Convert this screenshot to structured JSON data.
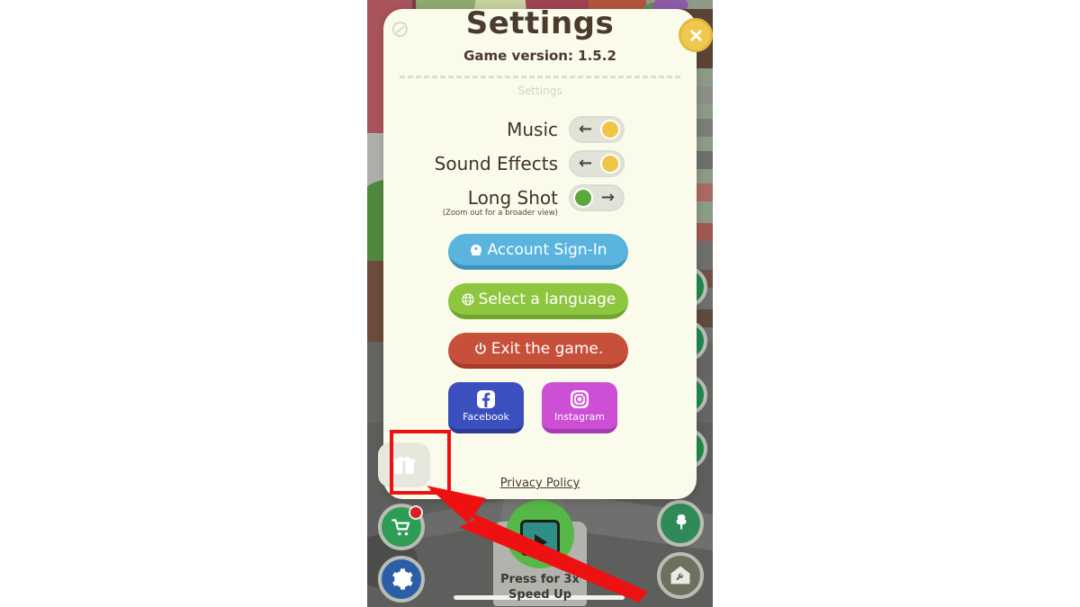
{
  "modal": {
    "title": "Settings",
    "corner_icon": "blocked-circle-icon",
    "close_icon": "close-icon",
    "game_version": "Game version: 1.5.2",
    "tab_label": "Settings",
    "toggles": [
      {
        "label": "Music",
        "state": "on",
        "knob_color": "#eec544",
        "arrow": "←",
        "arrow_side": "left"
      },
      {
        "label": "Sound Effects",
        "state": "on",
        "knob_color": "#eec544",
        "arrow": "←",
        "arrow_side": "left"
      },
      {
        "label": "Long Shot",
        "sub_label": "(Zoom out for a broader view)",
        "state": "off",
        "knob_color": "#58a83a",
        "arrow": "→",
        "arrow_side": "right"
      }
    ],
    "buttons": [
      {
        "label": "Account Sign-In",
        "icon": "person-badge-icon",
        "color": "#5ab4dd"
      },
      {
        "label": "Select a language",
        "icon": "globe-icon",
        "color": "#8ec63f"
      },
      {
        "label": "Exit the game.",
        "icon": "power-icon",
        "color": "#c7503a"
      }
    ],
    "social": [
      {
        "label": "Facebook",
        "icon": "facebook-icon",
        "color": "#3b4fbe"
      },
      {
        "label": "Instagram",
        "icon": "instagram-icon",
        "color": "#cc4fd6"
      }
    ],
    "gift_icon": "gift-icon",
    "privacy_policy": "Privacy Policy"
  },
  "game_hud": {
    "shop_icon": "shopping-cart-icon",
    "settings_icon": "gear-icon",
    "side_icon_1": "clover-icon",
    "side_icon_2": "house-wrench-icon",
    "speedup": {
      "line1": "Press for 3x",
      "line2": "Speed Up",
      "icon": "video-play-icon"
    },
    "side_stack_icon": "clover-icon",
    "side_stack_count": 4
  },
  "annotation": {
    "highlight_target": "gift-button",
    "arrow_color": "#ee1111",
    "box_color": "#ee1111"
  }
}
